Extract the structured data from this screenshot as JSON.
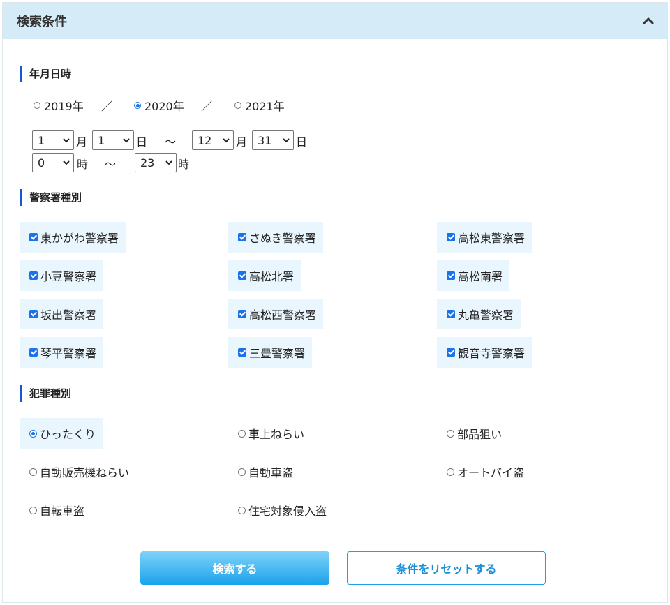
{
  "panel": {
    "title": "検索条件"
  },
  "date_section": {
    "title": "年月日時",
    "years": [
      {
        "label": "2019年",
        "selected": false
      },
      {
        "label": "2020年",
        "selected": true
      },
      {
        "label": "2021年",
        "selected": false
      }
    ],
    "separator": "／",
    "from_month": "1",
    "from_day": "1",
    "to_month": "12",
    "to_day": "31",
    "from_hour": "0",
    "to_hour": "23",
    "unit_month": "月",
    "unit_day": "日",
    "unit_hour": "時",
    "tilde": "～"
  },
  "station_section": {
    "title": "警察署種別",
    "stations": [
      {
        "label": "東かがわ警察署",
        "checked": true
      },
      {
        "label": "さぬき警察署",
        "checked": true
      },
      {
        "label": "高松東警察署",
        "checked": true
      },
      {
        "label": "小豆警察署",
        "checked": true
      },
      {
        "label": "高松北署",
        "checked": true
      },
      {
        "label": "高松南署",
        "checked": true
      },
      {
        "label": "坂出警察署",
        "checked": true
      },
      {
        "label": "高松西警察署",
        "checked": true
      },
      {
        "label": "丸亀警察署",
        "checked": true
      },
      {
        "label": "琴平警察署",
        "checked": true
      },
      {
        "label": "三豊警察署",
        "checked": true
      },
      {
        "label": "観音寺警察署",
        "checked": true
      }
    ]
  },
  "crime_section": {
    "title": "犯罪種別",
    "crimes": [
      {
        "label": "ひったくり",
        "selected": true
      },
      {
        "label": "車上ねらい",
        "selected": false
      },
      {
        "label": "部品狙い",
        "selected": false
      },
      {
        "label": "自動販売機ねらい",
        "selected": false
      },
      {
        "label": "自動車盗",
        "selected": false
      },
      {
        "label": "オートバイ盗",
        "selected": false
      },
      {
        "label": "自転車盗",
        "selected": false
      },
      {
        "label": "住宅対象侵入盗",
        "selected": false
      }
    ]
  },
  "buttons": {
    "search": "検索する",
    "reset": "条件をリセットする"
  },
  "colors": {
    "header_bg": "#d5ebf8",
    "accent": "#1455d9",
    "checkbox": "#1a73e8",
    "item_bg": "#eaf6fd",
    "button": "#1ba3ea"
  }
}
